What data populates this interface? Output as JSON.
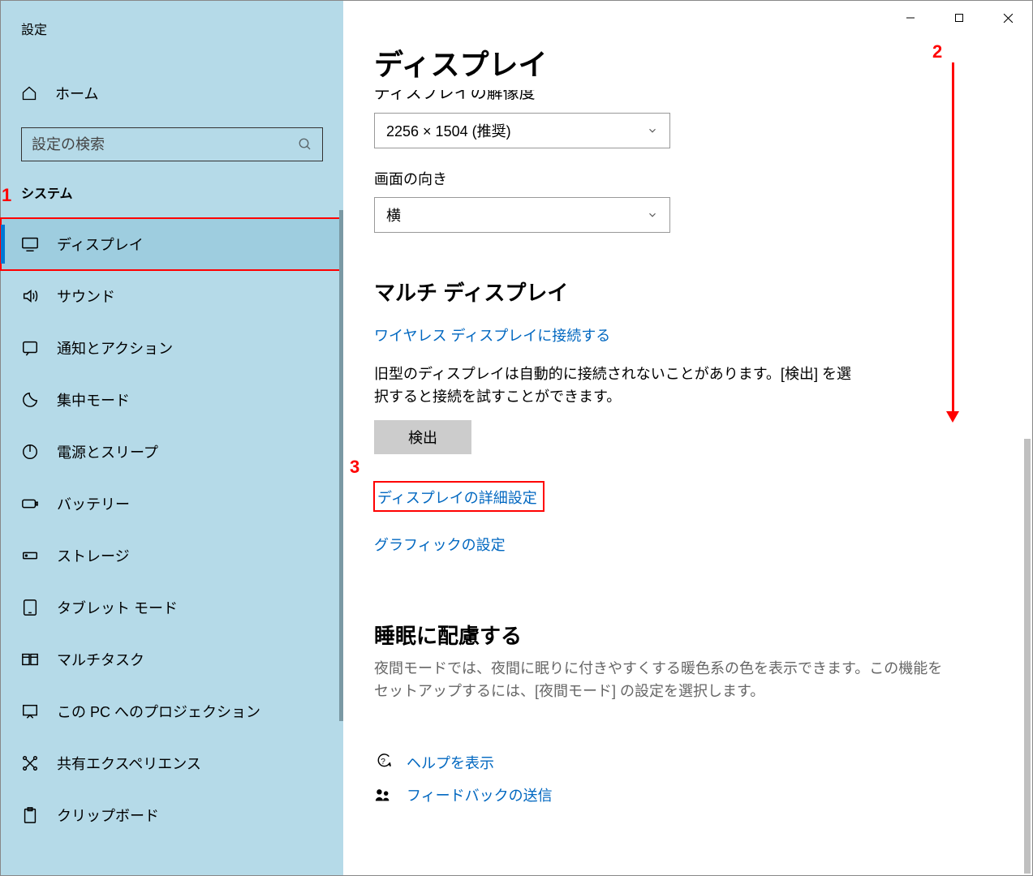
{
  "app_title": "設定",
  "home_label": "ホーム",
  "search_placeholder": "設定の検索",
  "section_label": "システム",
  "nav_items": [
    {
      "id": "display",
      "label": "ディスプレイ"
    },
    {
      "id": "sound",
      "label": "サウンド"
    },
    {
      "id": "notifications",
      "label": "通知とアクション"
    },
    {
      "id": "focus",
      "label": "集中モード"
    },
    {
      "id": "power",
      "label": "電源とスリープ"
    },
    {
      "id": "battery",
      "label": "バッテリー"
    },
    {
      "id": "storage",
      "label": "ストレージ"
    },
    {
      "id": "tablet",
      "label": "タブレット モード"
    },
    {
      "id": "multitask",
      "label": "マルチタスク"
    },
    {
      "id": "projection",
      "label": "この PC へのプロジェクション"
    },
    {
      "id": "shared",
      "label": "共有エクスペリエンス"
    },
    {
      "id": "clipboard",
      "label": "クリップボード"
    }
  ],
  "main": {
    "page_title": "ディスプレイ",
    "resolution_hint_cut": "ディスプレイの解像度",
    "resolution_value": "2256 × 1504 (推奨)",
    "orientation_label": "画面の向き",
    "orientation_value": "横",
    "multi_display_heading": "マルチ ディスプレイ",
    "wireless_link": "ワイヤレス ディスプレイに接続する",
    "detect_text": "旧型のディスプレイは自動的に接続されないことがあります。[検出] を選択すると接続を試すことができます。",
    "detect_button": "検出",
    "advanced_link": "ディスプレイの詳細設定",
    "graphics_link": "グラフィックの設定",
    "sleep_heading": "睡眠に配慮する",
    "sleep_text": "夜間モードでは、夜間に眠りに付きやすくする暖色系の色を表示できます。この機能をセットアップするには、[夜間モード] の設定を選択します。",
    "help_link": "ヘルプを表示",
    "feedback_link": "フィードバックの送信"
  },
  "annotations": {
    "a1": "1",
    "a2": "2",
    "a3": "3"
  }
}
